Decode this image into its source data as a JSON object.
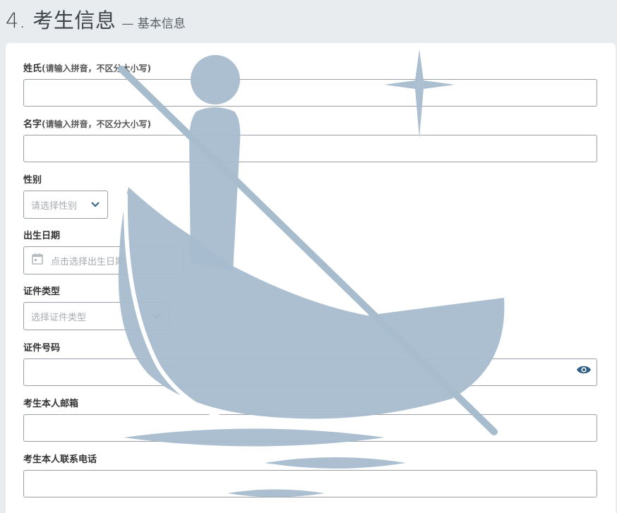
{
  "header": {
    "title": "4. 考生信息",
    "subtitle": "— 基本信息"
  },
  "form": {
    "last_name": {
      "label": "姓氏",
      "hint": "(请输入拼音，不区分大小写)",
      "value": ""
    },
    "first_name": {
      "label": "名字",
      "hint": "(请输入拼音，不区分大小写)",
      "value": ""
    },
    "gender": {
      "label": "性别",
      "placeholder": "请选择性别",
      "icon": "chevron-down-icon"
    },
    "birth_date": {
      "label": "出生日期",
      "placeholder": "点击选择出生日期",
      "icon": "calendar-icon"
    },
    "id_type": {
      "label": "证件类型",
      "placeholder": "选择证件类型",
      "icon": "chevron-down-icon"
    },
    "id_number": {
      "label": "证件号码",
      "value": "",
      "icon": "eye-icon"
    },
    "email": {
      "label": "考生本人邮箱",
      "value": ""
    },
    "phone": {
      "label": "考生本人联系电话",
      "value": ""
    }
  },
  "colors": {
    "background": "#e9ecef",
    "card": "#ffffff",
    "accent": "#2f5f86",
    "watermark": "#a7bccd"
  }
}
